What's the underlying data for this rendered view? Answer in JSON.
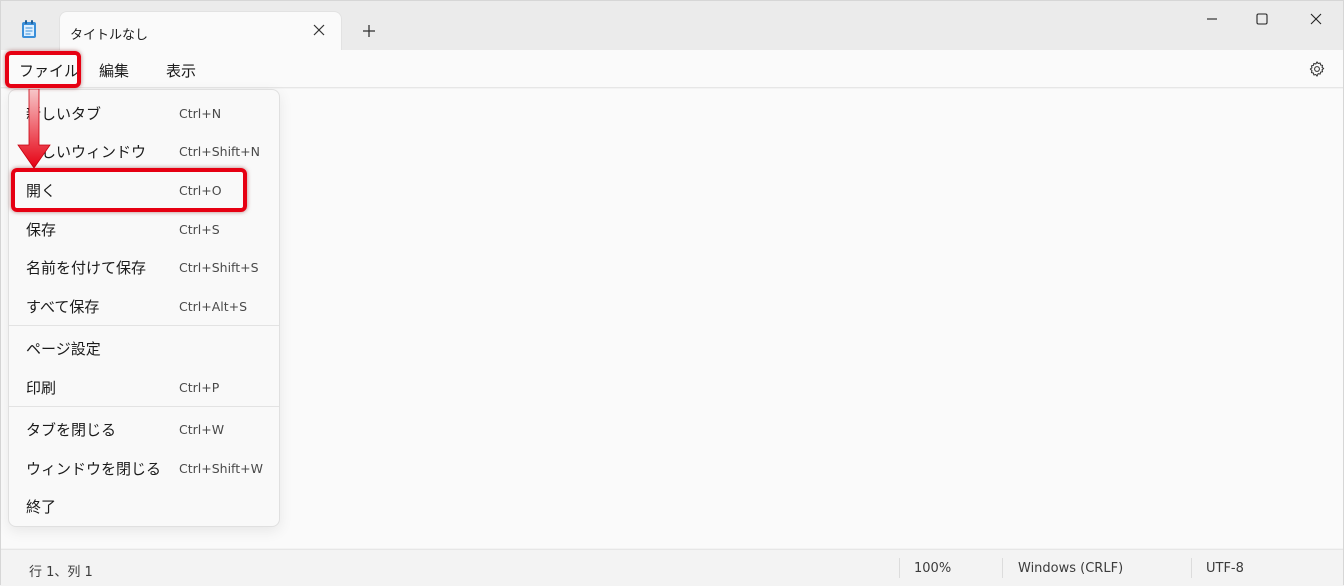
{
  "titlebar": {
    "tab_title": "タイトルなし",
    "icons": [
      "notepad-icon",
      "close-icon",
      "plus-icon",
      "minimize-icon",
      "maximize-icon",
      "close-icon"
    ]
  },
  "menubar": {
    "file": "ファイル",
    "edit": "編集",
    "view": "表示"
  },
  "file_menu": {
    "items": [
      {
        "label": "新しいタブ",
        "shortcut": "Ctrl+N"
      },
      {
        "label": "新しいウィンドウ",
        "shortcut": "Ctrl+Shift+N"
      },
      {
        "label": "開く",
        "shortcut": "Ctrl+O"
      },
      {
        "label": "保存",
        "shortcut": "Ctrl+S"
      },
      {
        "label": "名前を付けて保存",
        "shortcut": "Ctrl+Shift+S"
      },
      {
        "label": "すべて保存",
        "shortcut": "Ctrl+Alt+S"
      },
      {
        "label": "ページ設定",
        "shortcut": ""
      },
      {
        "label": "印刷",
        "shortcut": "Ctrl+P"
      },
      {
        "label": "タブを閉じる",
        "shortcut": "Ctrl+W"
      },
      {
        "label": "ウィンドウを閉じる",
        "shortcut": "Ctrl+Shift+W"
      },
      {
        "label": "終了",
        "shortcut": ""
      }
    ]
  },
  "statusbar": {
    "position": "行 1、列 1",
    "zoom": "100%",
    "line_ending": "Windows (CRLF)",
    "encoding": "UTF-8"
  },
  "colors": {
    "highlight": "#e60012",
    "background": "#f3f3f3",
    "editor": "#fafafa"
  }
}
